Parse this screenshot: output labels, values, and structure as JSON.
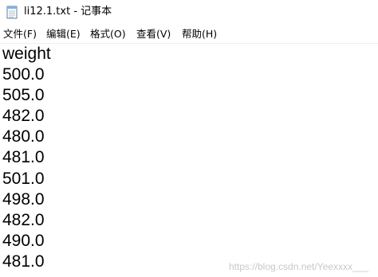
{
  "window": {
    "title": "li12.1.txt - 记事本",
    "icon": "notepad-icon"
  },
  "menu": {
    "items": [
      {
        "label": "文件(F)"
      },
      {
        "label": "编辑(E)"
      },
      {
        "label": "格式(O)"
      },
      {
        "label": "查看(V)"
      },
      {
        "label": "帮助(H)"
      }
    ]
  },
  "document": {
    "lines": [
      "weight",
      "500.0",
      "505.0",
      "482.0",
      "480.0",
      "481.0",
      "501.0",
      "498.0",
      "482.0",
      "490.0",
      "481.0"
    ]
  },
  "watermark": {
    "text": "https://blog.csdn.net/Yeexxxx___"
  }
}
